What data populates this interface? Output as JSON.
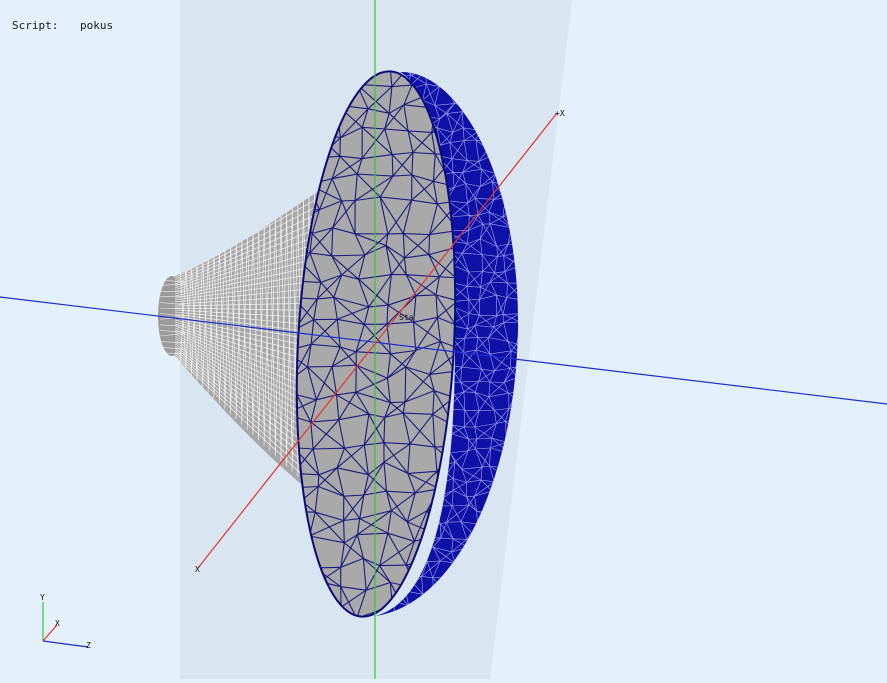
{
  "header": {
    "script_label": "Script:",
    "script_name": "pokus"
  },
  "colors": {
    "background": "#e4f0fb",
    "clip_plane": "#cfdce9",
    "axis_x": "#e8322e",
    "axis_y": "#2ecc2e",
    "axis_z": "#1d2ecc",
    "mesh_body_fill": "#a4a4a4",
    "mesh_body_lines": "#ffffff",
    "mesh_front_lines": "#0a0a7a",
    "mesh_rim_fill": "#0e11a6"
  },
  "scene": {
    "axis_x_end_label": "+X",
    "axis_x_start_label": "X",
    "center_label": "Sta",
    "model_icon": "mesh-model-icon"
  },
  "triad": {
    "y_label": "Y",
    "x_label": "X",
    "z_label": "Z"
  }
}
